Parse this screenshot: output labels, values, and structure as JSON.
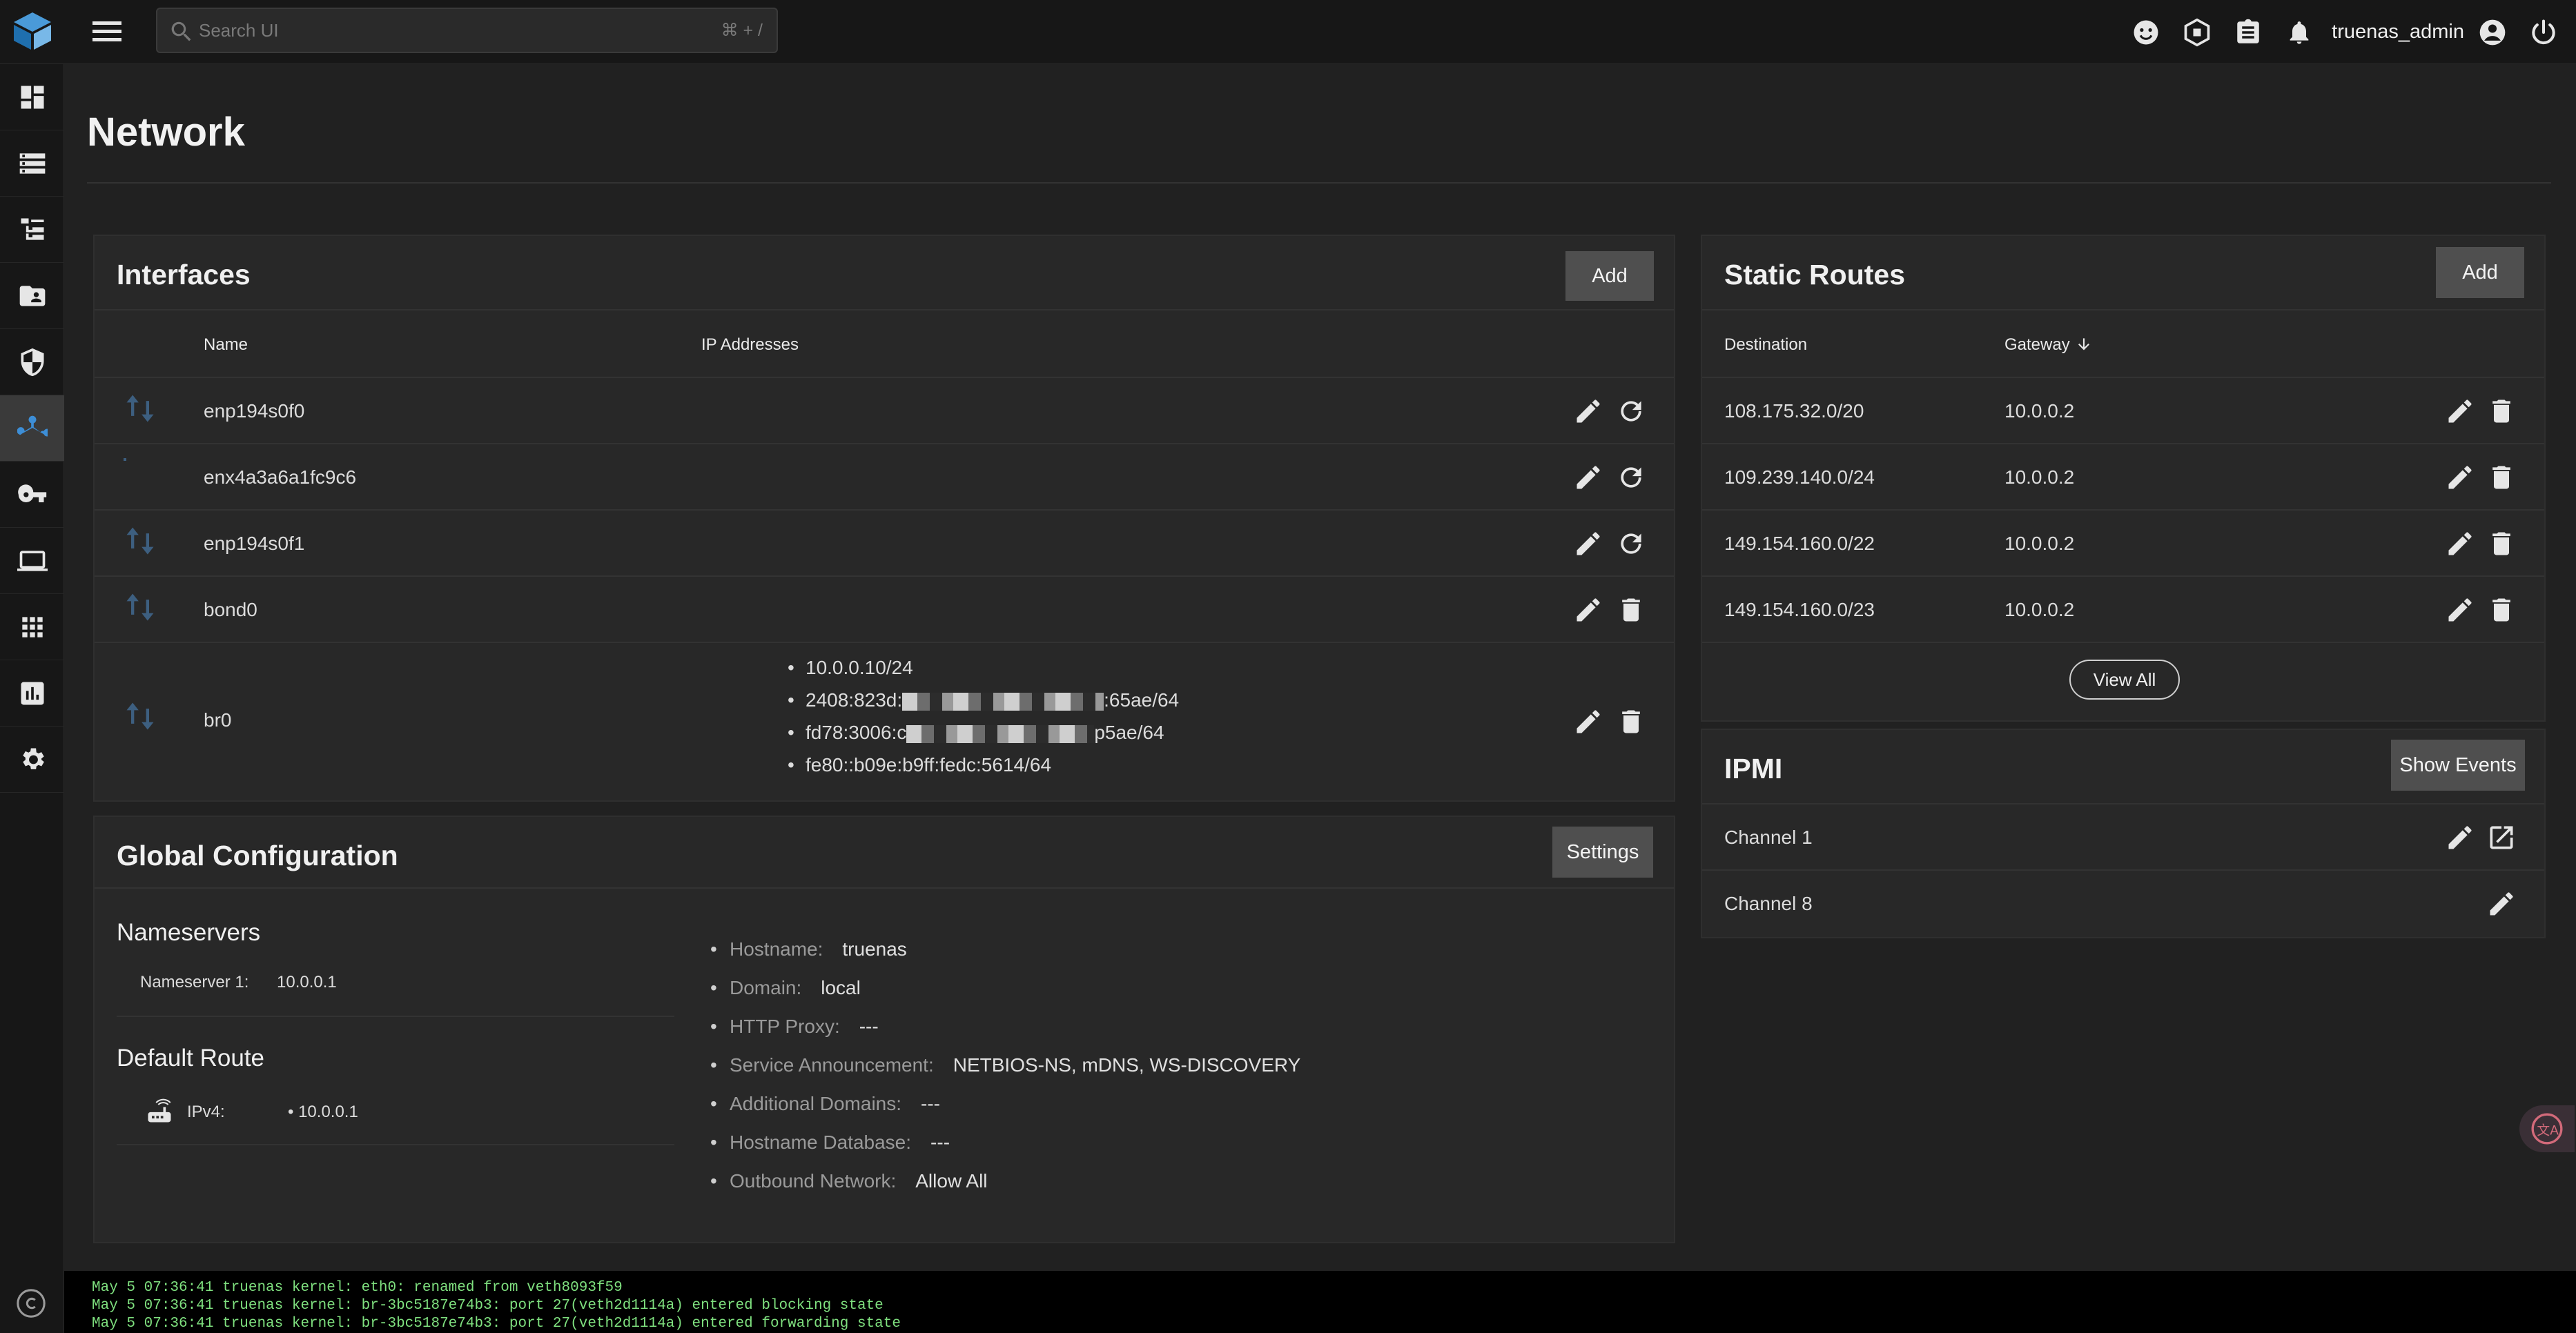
{
  "app": {
    "name": "TrueNAS"
  },
  "topbar": {
    "search_placeholder": "Search UI",
    "search_shortcut": "⌘ + /",
    "username": "truenas_admin"
  },
  "sidebar": {
    "items": [
      {
        "icon": "dashboard-icon"
      },
      {
        "icon": "storage-icon"
      },
      {
        "icon": "datasets-icon"
      },
      {
        "icon": "shares-icon"
      },
      {
        "icon": "credentials-icon"
      },
      {
        "icon": "network-icon",
        "active": true
      },
      {
        "icon": "key-icon"
      },
      {
        "icon": "virtualization-icon"
      },
      {
        "icon": "apps-icon"
      },
      {
        "icon": "reporting-icon"
      },
      {
        "icon": "settings-icon"
      }
    ]
  },
  "page": {
    "title": "Network"
  },
  "interfaces": {
    "title": "Interfaces",
    "add_label": "Add",
    "columns": {
      "name": "Name",
      "ip": "IP Addresses"
    },
    "rows": [
      {
        "name": "enp194s0f0",
        "status": "updown",
        "actions": [
          "edit",
          "reset"
        ]
      },
      {
        "name": "enx4a3a6a1fc9c6",
        "status": "dot",
        "actions": [
          "edit",
          "reset"
        ]
      },
      {
        "name": "enp194s0f1",
        "status": "updown",
        "actions": [
          "edit",
          "reset"
        ]
      },
      {
        "name": "bond0",
        "status": "updown",
        "actions": [
          "edit",
          "delete"
        ]
      },
      {
        "name": "br0",
        "status": "updown",
        "actions": [
          "edit",
          "delete"
        ],
        "ips": [
          {
            "pre": "10.0.0.10/24",
            "post": ""
          },
          {
            "pre": "2408:823d:",
            "post": ":65ae/64"
          },
          {
            "pre": "fd78:3006:c",
            "post": "p5ae/64"
          },
          {
            "pre": "fe80::b09e:b9ff:fedc:5614/64",
            "post": ""
          }
        ]
      }
    ]
  },
  "global_config": {
    "title": "Global Configuration",
    "settings_label": "Settings",
    "nameservers_heading": "Nameservers",
    "nameserver1_label": "Nameserver 1:",
    "nameserver1_value": "10.0.0.1",
    "default_route_heading": "Default Route",
    "ipv4_label": "IPv4:",
    "ipv4_value": "10.0.0.1",
    "details": [
      {
        "k": "Hostname:",
        "v": "truenas"
      },
      {
        "k": "Domain:",
        "v": "local"
      },
      {
        "k": "HTTP Proxy:",
        "v": "---"
      },
      {
        "k": "Service Announcement:",
        "v": "NETBIOS-NS, mDNS, WS-DISCOVERY"
      },
      {
        "k": "Additional Domains:",
        "v": "---"
      },
      {
        "k": "Hostname Database:",
        "v": "---"
      },
      {
        "k": "Outbound Network:",
        "v": "Allow All"
      }
    ]
  },
  "static_routes": {
    "title": "Static Routes",
    "add_label": "Add",
    "columns": {
      "destination": "Destination",
      "gateway": "Gateway"
    },
    "rows": [
      {
        "destination": "108.175.32.0/20",
        "gateway": "10.0.0.2"
      },
      {
        "destination": "109.239.140.0/24",
        "gateway": "10.0.0.2"
      },
      {
        "destination": "149.154.160.0/22",
        "gateway": "10.0.0.2"
      },
      {
        "destination": "149.154.160.0/23",
        "gateway": "10.0.0.2"
      }
    ],
    "view_all_label": "View All"
  },
  "ipmi": {
    "title": "IPMI",
    "show_events_label": "Show Events",
    "channels": [
      "Channel 1",
      "Channel 8"
    ]
  },
  "console": {
    "lines": [
      "May  5 07:36:41 truenas kernel: eth0: renamed from veth8093f59",
      "May  5 07:36:41 truenas kernel: br-3bc5187e74b3: port 27(veth2d1114a) entered blocking state",
      "May  5 07:36:41 truenas kernel: br-3bc5187e74b3: port 27(veth2d1114a) entered forwarding state"
    ]
  },
  "colors": {
    "accent": "#3d8ed6",
    "panel": "#282828",
    "background": "#212121"
  }
}
